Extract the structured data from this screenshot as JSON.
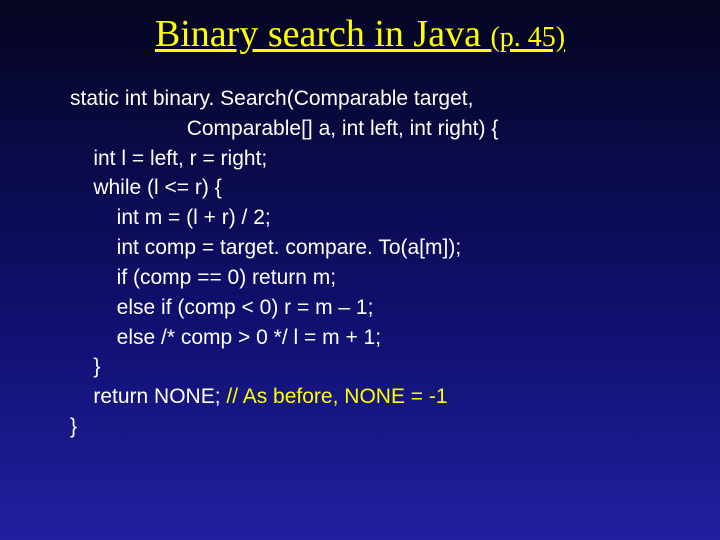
{
  "title_main": "Binary search in Java ",
  "title_sub": "(p. 45)",
  "code": {
    "l1": "static int binary. Search(Comparable target,",
    "l2": "                    Comparable[] a, int left, int right) {",
    "l3": "    int l = left, r = right;",
    "l4": "    while (l <= r) {",
    "l5": "        int m = (l + r) / 2;",
    "l6": "        int comp = target. compare. To(a[m]);",
    "l7": "        if (comp == 0) return m;",
    "l8": "        else if (comp < 0) r = m – 1;",
    "l9": "        else /* comp > 0 */ l = m + 1;",
    "l10": "    }",
    "l11a": "    return NONE; ",
    "l11b": "// As before, NONE = -1",
    "l12": "}"
  }
}
